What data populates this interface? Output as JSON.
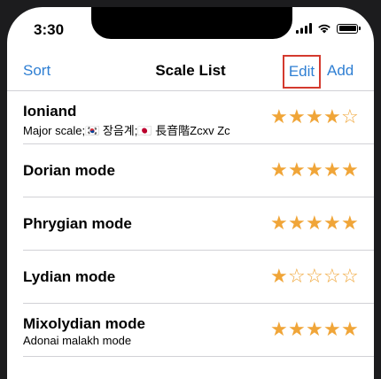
{
  "status": {
    "time": "3:30"
  },
  "nav": {
    "sort_label": "Sort",
    "title": "Scale List",
    "edit_label": "Edit",
    "add_label": "Add"
  },
  "rows": [
    {
      "name": "Ioniand",
      "subtitle": "Major scale;🇰🇷 장음계;🇯🇵 長音階Zcxv Zc",
      "rating": 4,
      "max": 5
    },
    {
      "name": "Dorian mode",
      "subtitle": "",
      "rating": 5,
      "max": 5
    },
    {
      "name": "Phrygian mode",
      "subtitle": "",
      "rating": 5,
      "max": 5
    },
    {
      "name": "Lydian mode",
      "subtitle": "",
      "rating": 1,
      "max": 5
    },
    {
      "name": "Mixolydian mode",
      "subtitle": "Adonai malakh mode",
      "rating": 5,
      "max": 5
    }
  ],
  "colors": {
    "accent": "#2f7fd3",
    "star": "#f0a538",
    "highlight": "#d43a2e"
  }
}
